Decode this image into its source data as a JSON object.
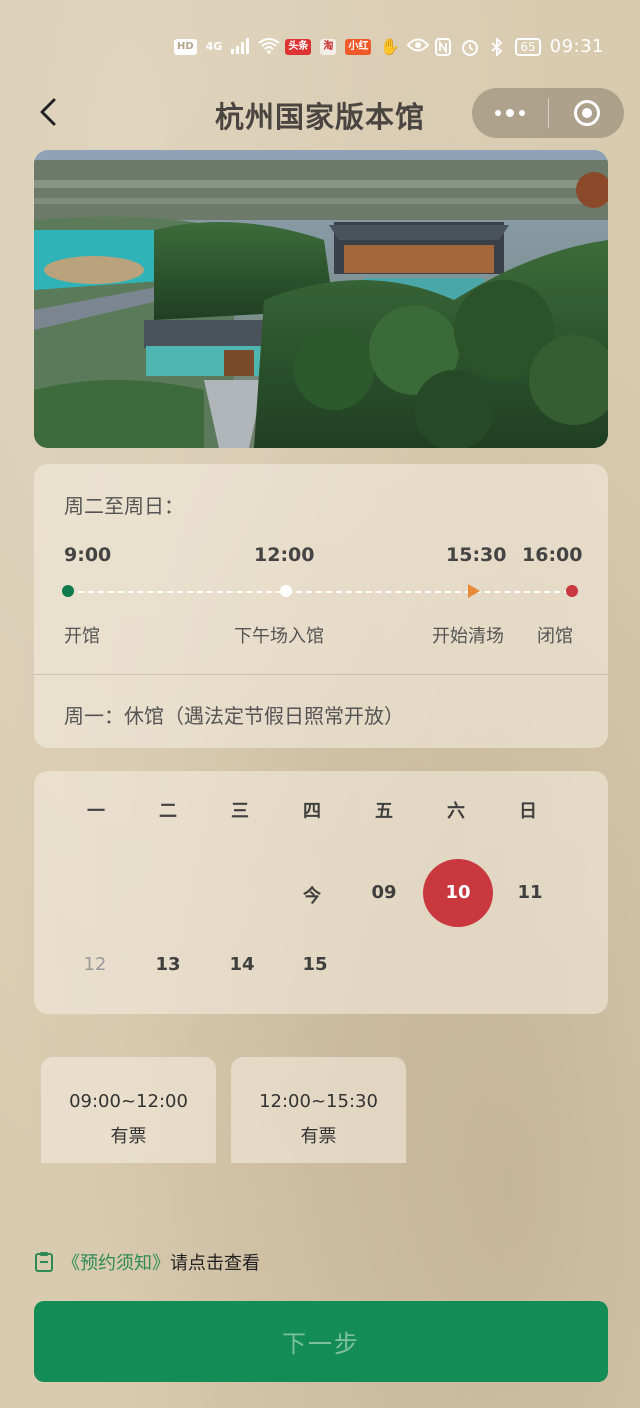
{
  "status_bar": {
    "hd": "HD",
    "network": "4G",
    "badges": [
      "头条",
      "淘",
      "小红"
    ],
    "battery": "65",
    "time": "09:31"
  },
  "nav": {
    "title": "杭州国家版本馆"
  },
  "schedule": {
    "heading": "周二至周日：",
    "times": [
      "9:00",
      "12:00",
      "15:30",
      "16:00"
    ],
    "labels": [
      "开馆",
      "下午场入馆",
      "开始清场",
      "闭馆"
    ],
    "colors": {
      "open": "#0f7a4e",
      "afternoon": "#ffffff",
      "clear": "#e8893a",
      "close": "#c9383e"
    },
    "monday_note": "周一：休馆（遇法定节假日照常开放）"
  },
  "calendar": {
    "weekdays": [
      "一",
      "二",
      "三",
      "四",
      "五",
      "六",
      "日"
    ],
    "row1": [
      "今",
      "09",
      "10",
      "11"
    ],
    "row2": [
      "12",
      "13",
      "14",
      "15"
    ],
    "selected": "10",
    "disabled": [
      "12"
    ],
    "selected_color": "#c9383e"
  },
  "slots": [
    {
      "time": "09:00~12:00",
      "status": "有票"
    },
    {
      "time": "12:00~15:30",
      "status": "有票"
    }
  ],
  "notice": {
    "link": "《预约须知》",
    "text": "请点击查看"
  },
  "next_button": {
    "label": "下一步",
    "color": "#138c55"
  }
}
